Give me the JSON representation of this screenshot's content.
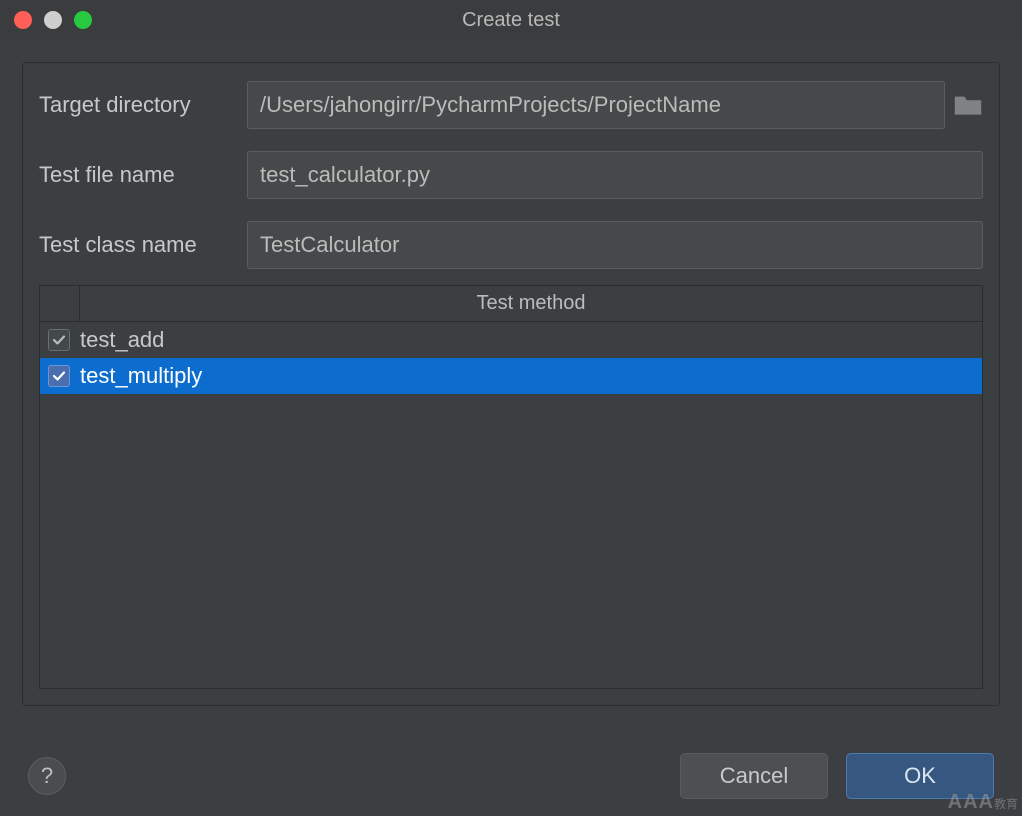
{
  "window": {
    "title": "Create test"
  },
  "form": {
    "target_dir_label": "Target directory",
    "target_dir_value": "/Users/jahongirr/PycharmProjects/ProjectName",
    "test_file_label": "Test file name",
    "test_file_value": "test_calculator.py",
    "test_class_label": "Test class name",
    "test_class_value": "TestCalculator"
  },
  "table": {
    "header": "Test method",
    "rows": [
      {
        "label": "test_add",
        "checked": true,
        "selected": false
      },
      {
        "label": "test_multiply",
        "checked": true,
        "selected": true
      }
    ]
  },
  "buttons": {
    "help": "?",
    "cancel": "Cancel",
    "ok": "OK"
  },
  "watermark": "AAA教育"
}
